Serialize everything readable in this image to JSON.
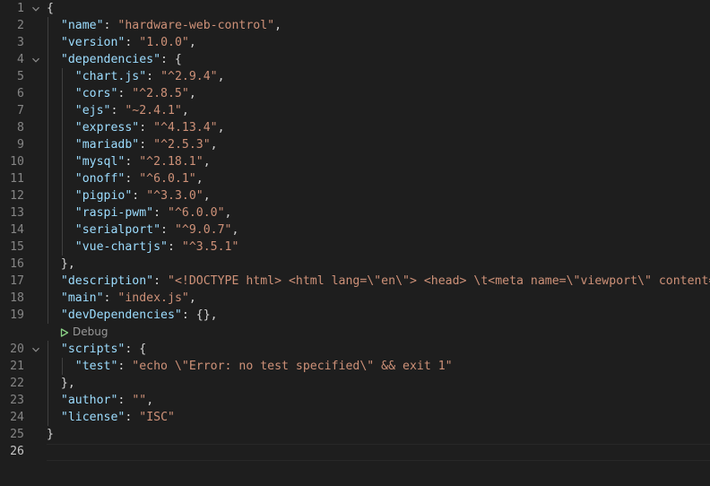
{
  "editor": {
    "codelens_label": "Debug",
    "lines": [
      {
        "num": "1",
        "fold": true,
        "indent": 0,
        "tokens": [
          {
            "t": "{",
            "c": "p"
          }
        ]
      },
      {
        "num": "2",
        "fold": false,
        "indent": 1,
        "tokens": [
          {
            "t": "\"name\"",
            "c": "k"
          },
          {
            "t": ": ",
            "c": "p"
          },
          {
            "t": "\"hardware-web-control\"",
            "c": "s"
          },
          {
            "t": ",",
            "c": "p"
          }
        ]
      },
      {
        "num": "3",
        "fold": false,
        "indent": 1,
        "tokens": [
          {
            "t": "\"version\"",
            "c": "k"
          },
          {
            "t": ": ",
            "c": "p"
          },
          {
            "t": "\"1.0.0\"",
            "c": "s"
          },
          {
            "t": ",",
            "c": "p"
          }
        ]
      },
      {
        "num": "4",
        "fold": true,
        "indent": 1,
        "tokens": [
          {
            "t": "\"dependencies\"",
            "c": "k"
          },
          {
            "t": ": {",
            "c": "p"
          }
        ]
      },
      {
        "num": "5",
        "fold": false,
        "indent": 2,
        "tokens": [
          {
            "t": "\"chart.js\"",
            "c": "k"
          },
          {
            "t": ": ",
            "c": "p"
          },
          {
            "t": "\"^2.9.4\"",
            "c": "s"
          },
          {
            "t": ",",
            "c": "p"
          }
        ]
      },
      {
        "num": "6",
        "fold": false,
        "indent": 2,
        "tokens": [
          {
            "t": "\"cors\"",
            "c": "k"
          },
          {
            "t": ": ",
            "c": "p"
          },
          {
            "t": "\"^2.8.5\"",
            "c": "s"
          },
          {
            "t": ",",
            "c": "p"
          }
        ]
      },
      {
        "num": "7",
        "fold": false,
        "indent": 2,
        "tokens": [
          {
            "t": "\"ejs\"",
            "c": "k"
          },
          {
            "t": ": ",
            "c": "p"
          },
          {
            "t": "\"~2.4.1\"",
            "c": "s"
          },
          {
            "t": ",",
            "c": "p"
          }
        ]
      },
      {
        "num": "8",
        "fold": false,
        "indent": 2,
        "tokens": [
          {
            "t": "\"express\"",
            "c": "k"
          },
          {
            "t": ": ",
            "c": "p"
          },
          {
            "t": "\"^4.13.4\"",
            "c": "s"
          },
          {
            "t": ",",
            "c": "p"
          }
        ]
      },
      {
        "num": "9",
        "fold": false,
        "indent": 2,
        "tokens": [
          {
            "t": "\"mariadb\"",
            "c": "k"
          },
          {
            "t": ": ",
            "c": "p"
          },
          {
            "t": "\"^2.5.3\"",
            "c": "s"
          },
          {
            "t": ",",
            "c": "p"
          }
        ]
      },
      {
        "num": "10",
        "fold": false,
        "indent": 2,
        "tokens": [
          {
            "t": "\"mysql\"",
            "c": "k"
          },
          {
            "t": ": ",
            "c": "p"
          },
          {
            "t": "\"^2.18.1\"",
            "c": "s"
          },
          {
            "t": ",",
            "c": "p"
          }
        ]
      },
      {
        "num": "11",
        "fold": false,
        "indent": 2,
        "tokens": [
          {
            "t": "\"onoff\"",
            "c": "k"
          },
          {
            "t": ": ",
            "c": "p"
          },
          {
            "t": "\"^6.0.1\"",
            "c": "s"
          },
          {
            "t": ",",
            "c": "p"
          }
        ]
      },
      {
        "num": "12",
        "fold": false,
        "indent": 2,
        "tokens": [
          {
            "t": "\"pigpio\"",
            "c": "k"
          },
          {
            "t": ": ",
            "c": "p"
          },
          {
            "t": "\"^3.3.0\"",
            "c": "s"
          },
          {
            "t": ",",
            "c": "p"
          }
        ]
      },
      {
        "num": "13",
        "fold": false,
        "indent": 2,
        "tokens": [
          {
            "t": "\"raspi-pwm\"",
            "c": "k"
          },
          {
            "t": ": ",
            "c": "p"
          },
          {
            "t": "\"^6.0.0\"",
            "c": "s"
          },
          {
            "t": ",",
            "c": "p"
          }
        ]
      },
      {
        "num": "14",
        "fold": false,
        "indent": 2,
        "tokens": [
          {
            "t": "\"serialport\"",
            "c": "k"
          },
          {
            "t": ": ",
            "c": "p"
          },
          {
            "t": "\"^9.0.7\"",
            "c": "s"
          },
          {
            "t": ",",
            "c": "p"
          }
        ]
      },
      {
        "num": "15",
        "fold": false,
        "indent": 2,
        "tokens": [
          {
            "t": "\"vue-chartjs\"",
            "c": "k"
          },
          {
            "t": ": ",
            "c": "p"
          },
          {
            "t": "\"^3.5.1\"",
            "c": "s"
          }
        ]
      },
      {
        "num": "16",
        "fold": false,
        "indent": 1,
        "tokens": [
          {
            "t": "},",
            "c": "p"
          }
        ]
      },
      {
        "num": "17",
        "fold": false,
        "indent": 1,
        "tokens": [
          {
            "t": "\"description\"",
            "c": "k"
          },
          {
            "t": ": ",
            "c": "p"
          },
          {
            "t": "\"<!DOCTYPE html> <html lang=\\\"en\\\"> <head> \\t<meta name=\\\"viewport\\\" content=\\\"w",
            "c": "s"
          }
        ]
      },
      {
        "num": "18",
        "fold": false,
        "indent": 1,
        "tokens": [
          {
            "t": "\"main\"",
            "c": "k"
          },
          {
            "t": ": ",
            "c": "p"
          },
          {
            "t": "\"index.js\"",
            "c": "s"
          },
          {
            "t": ",",
            "c": "p"
          }
        ]
      },
      {
        "num": "19",
        "fold": false,
        "indent": 1,
        "tokens": [
          {
            "t": "\"devDependencies\"",
            "c": "k"
          },
          {
            "t": ": {},",
            "c": "p"
          }
        ]
      },
      {
        "num": "20",
        "fold": true,
        "indent": 1,
        "tokens": [
          {
            "t": "\"scripts\"",
            "c": "k"
          },
          {
            "t": ": {",
            "c": "p"
          }
        ]
      },
      {
        "num": "21",
        "fold": false,
        "indent": 2,
        "tokens": [
          {
            "t": "\"test\"",
            "c": "k"
          },
          {
            "t": ": ",
            "c": "p"
          },
          {
            "t": "\"echo \\\"Error: no test specified\\\" && exit 1\"",
            "c": "s"
          }
        ]
      },
      {
        "num": "22",
        "fold": false,
        "indent": 1,
        "tokens": [
          {
            "t": "},",
            "c": "p"
          }
        ]
      },
      {
        "num": "23",
        "fold": false,
        "indent": 1,
        "tokens": [
          {
            "t": "\"author\"",
            "c": "k"
          },
          {
            "t": ": ",
            "c": "p"
          },
          {
            "t": "\"\"",
            "c": "s"
          },
          {
            "t": ",",
            "c": "p"
          }
        ]
      },
      {
        "num": "24",
        "fold": false,
        "indent": 1,
        "tokens": [
          {
            "t": "\"license\"",
            "c": "k"
          },
          {
            "t": ": ",
            "c": "p"
          },
          {
            "t": "\"ISC\"",
            "c": "s"
          }
        ]
      },
      {
        "num": "25",
        "fold": false,
        "indent": 0,
        "tokens": [
          {
            "t": "}",
            "c": "p"
          }
        ]
      },
      {
        "num": "26",
        "fold": false,
        "indent": 0,
        "active": true,
        "tokens": []
      }
    ]
  }
}
